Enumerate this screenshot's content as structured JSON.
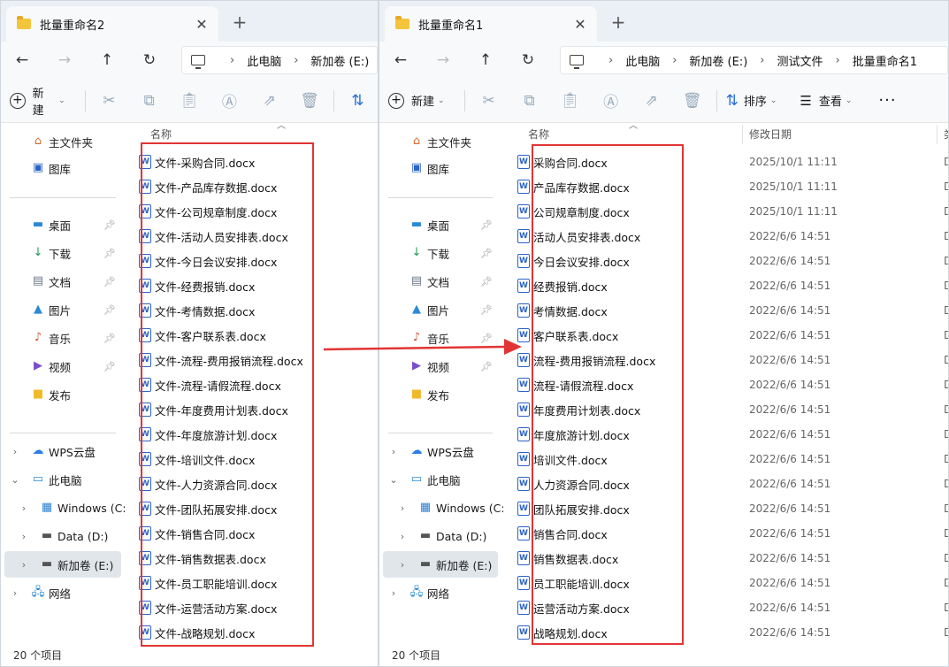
{
  "windows": {
    "left": {
      "tab_title": "批量重命名2",
      "breadcrumb": [
        "此电脑",
        "新加卷 (E:)"
      ],
      "toolbar": {
        "new_label": "新建"
      },
      "column_name": "名称",
      "files": [
        "文件-采购合同.docx",
        "文件-产品库存数据.docx",
        "文件-公司规章制度.docx",
        "文件-活动人员安排表.docx",
        "文件-今日会议安排.docx",
        "文件-经费报销.docx",
        "文件-考情数据.docx",
        "文件-客户联系表.docx",
        "文件-流程-费用报销流程.docx",
        "文件-流程-请假流程.docx",
        "文件-年度费用计划表.docx",
        "文件-年度旅游计划.docx",
        "文件-培训文件.docx",
        "文件-人力资源合同.docx",
        "文件-团队拓展安排.docx",
        "文件-销售合同.docx",
        "文件-销售数据表.docx",
        "文件-员工职能培训.docx",
        "文件-运营活动方案.docx",
        "文件-战略规划.docx"
      ],
      "status": "20 个项目"
    },
    "right": {
      "tab_title": "批量重命名1",
      "breadcrumb": [
        "此电脑",
        "新加卷 (E:)",
        "测试文件",
        "批量重命名1"
      ],
      "toolbar": {
        "new_label": "新建",
        "sort_label": "排序",
        "view_label": "查看",
        "more_label": "···"
      },
      "column_name": "名称",
      "column_date": "修改日期",
      "column_type_partial": "类",
      "files": [
        {
          "name": "采购合同.docx",
          "date": "2025/10/1 11:11"
        },
        {
          "name": "产品库存数据.docx",
          "date": "2025/10/1 11:11"
        },
        {
          "name": "公司规章制度.docx",
          "date": "2025/10/1 11:11"
        },
        {
          "name": "活动人员安排表.docx",
          "date": "2022/6/6 14:51"
        },
        {
          "name": "今日会议安排.docx",
          "date": "2022/6/6 14:51"
        },
        {
          "name": "经费报销.docx",
          "date": "2022/6/6 14:51"
        },
        {
          "name": "考情数据.docx",
          "date": "2022/6/6 14:51"
        },
        {
          "name": "客户联系表.docx",
          "date": "2022/6/6 14:51"
        },
        {
          "name": "流程-费用报销流程.docx",
          "date": "2022/6/6 14:51"
        },
        {
          "name": "流程-请假流程.docx",
          "date": "2022/6/6 14:51"
        },
        {
          "name": "年度费用计划表.docx",
          "date": "2022/6/6 14:51"
        },
        {
          "name": "年度旅游计划.docx",
          "date": "2022/6/6 14:51"
        },
        {
          "name": "培训文件.docx",
          "date": "2022/6/6 14:51"
        },
        {
          "name": "人力资源合同.docx",
          "date": "2022/6/6 14:51"
        },
        {
          "name": "团队拓展安排.docx",
          "date": "2022/6/6 14:51"
        },
        {
          "name": "销售合同.docx",
          "date": "2022/6/6 14:51"
        },
        {
          "name": "销售数据表.docx",
          "date": "2022/6/6 14:51"
        },
        {
          "name": "员工职能培训.docx",
          "date": "2022/6/6 14:51"
        },
        {
          "name": "运营活动方案.docx",
          "date": "2022/6/6 14:51"
        },
        {
          "name": "战略规划.docx",
          "date": "2022/6/6 14:51"
        }
      ],
      "file_type_partial": "D",
      "status": "20 个项目"
    }
  },
  "sidebar": {
    "quick": [
      "主文件夹",
      "图库"
    ],
    "pinned": [
      "桌面",
      "下载",
      "文档",
      "图片",
      "音乐",
      "视频",
      "发布"
    ],
    "tree": [
      "WPS云盘",
      "此电脑",
      "Windows (C:",
      "Data (D:)",
      "新加卷 (E:)",
      "网络"
    ]
  },
  "annotation_color": "#e23434"
}
